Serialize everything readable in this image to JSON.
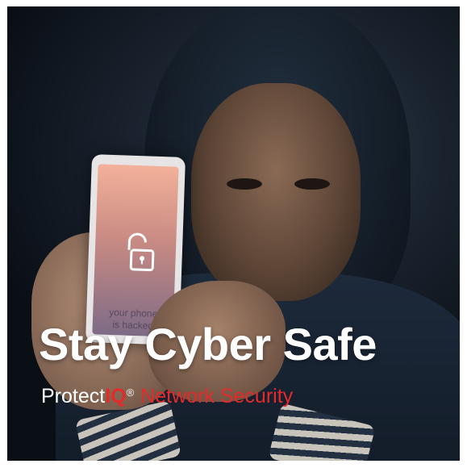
{
  "phone": {
    "message_line1": "your phone",
    "message_line2": "is hacked",
    "icon": "unlocked-padlock-icon"
  },
  "overlay": {
    "headline": "Stay Cyber Safe",
    "brand_prefix": "Protect",
    "brand_iq": "IQ",
    "brand_reg": "®",
    "brand_tagline": "Network Security"
  },
  "colors": {
    "accent_red": "#e52a2a",
    "headline_white": "#ffffff",
    "background_dark": "#0e141c"
  }
}
